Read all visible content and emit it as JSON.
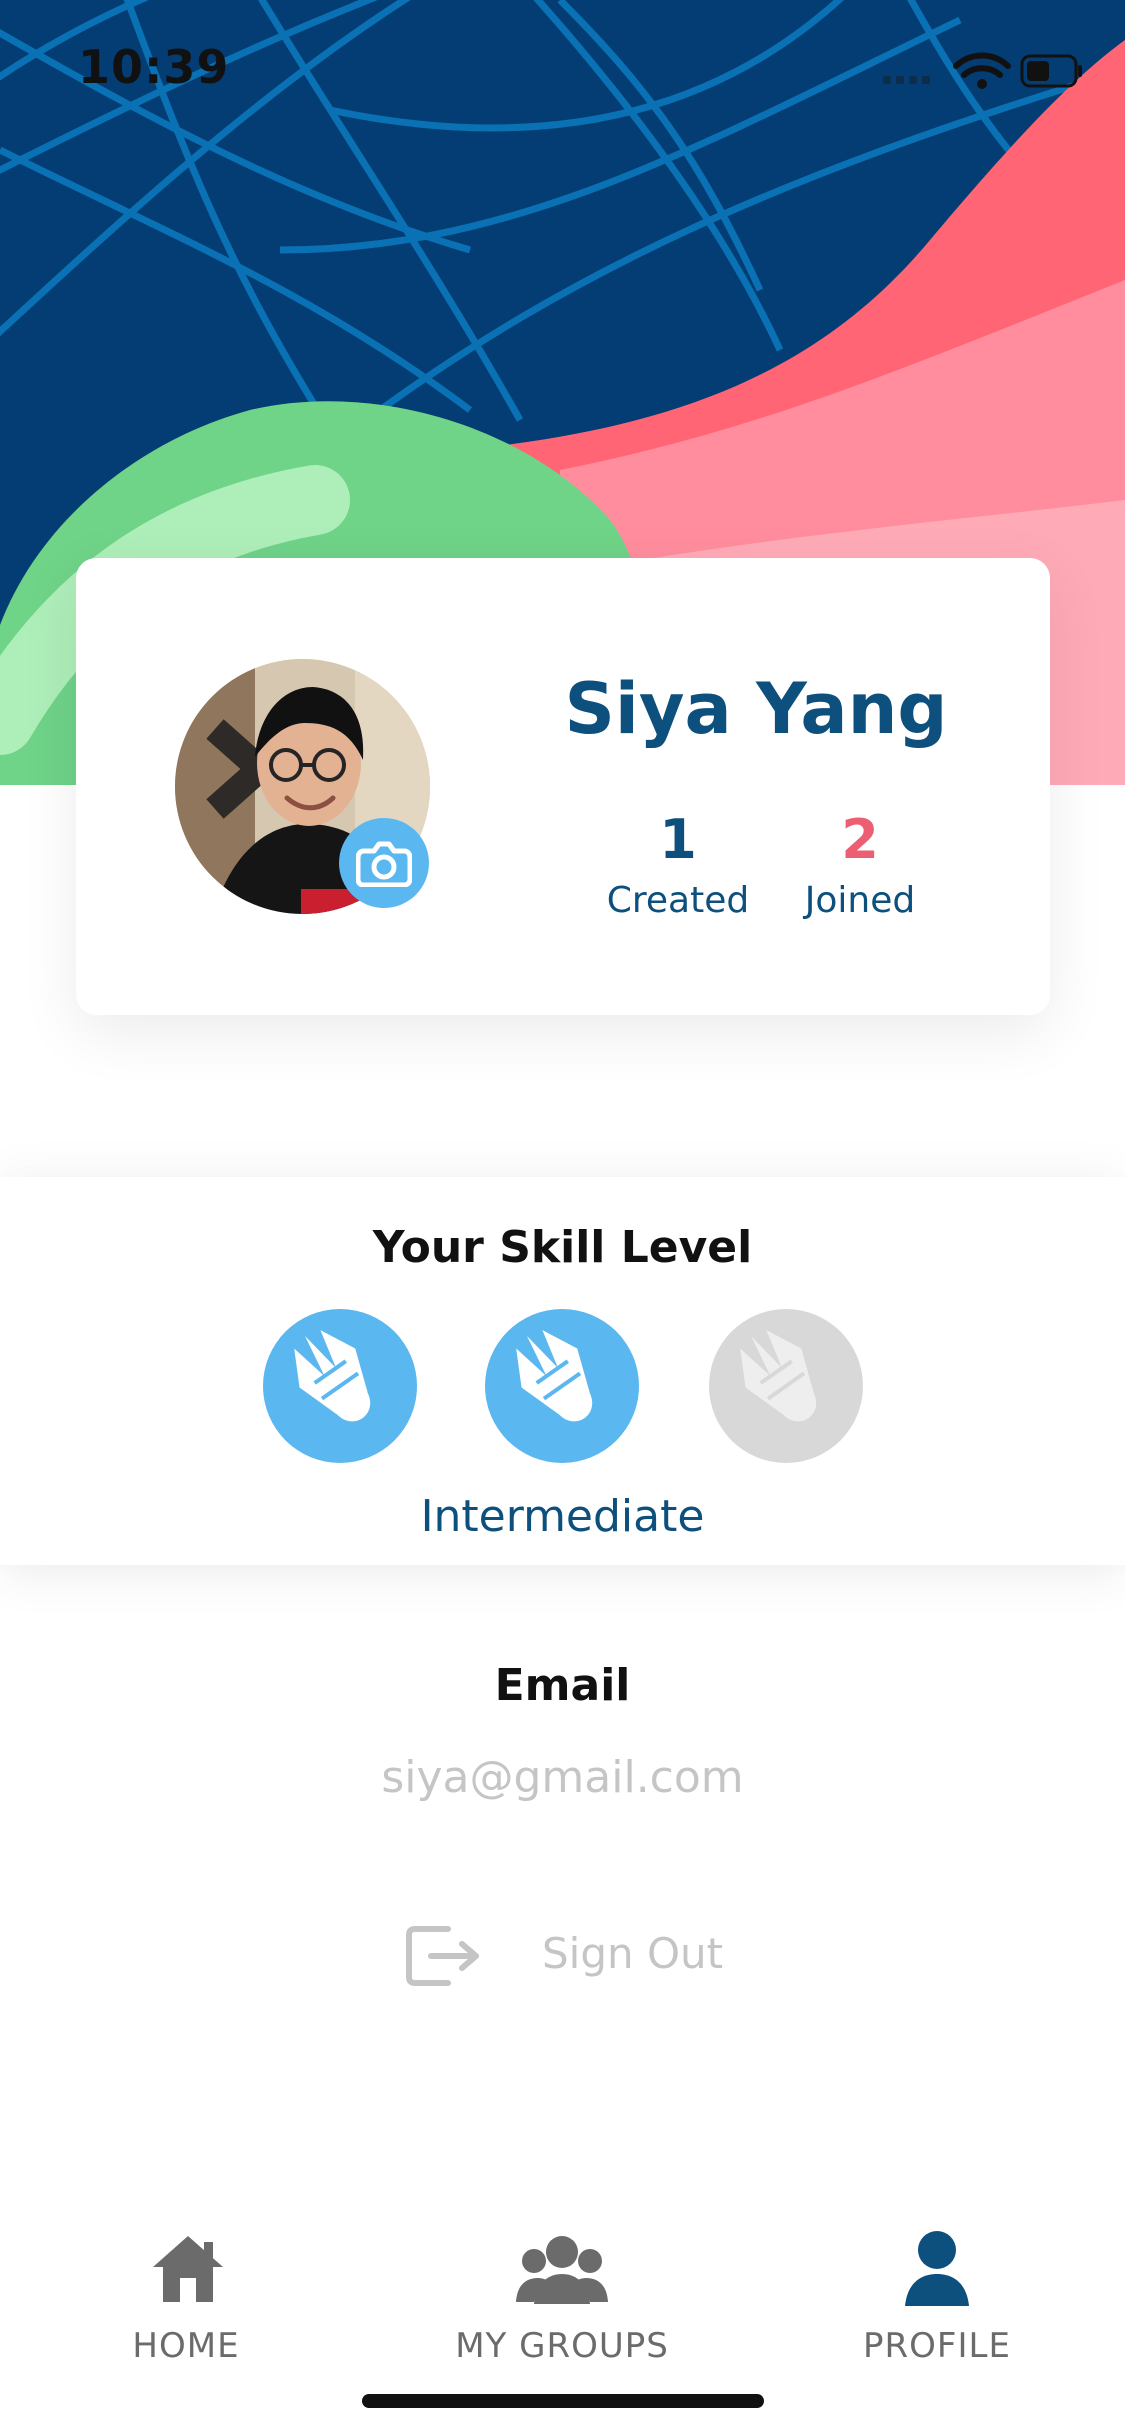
{
  "status_bar": {
    "time": "10:39",
    "icons": [
      "signal-icon",
      "wifi-icon",
      "battery-icon"
    ]
  },
  "profile": {
    "name": "Siya Yang",
    "camera_icon": "camera-icon",
    "stats": [
      {
        "value": "1",
        "label": "Created",
        "color": "#0d4f7d"
      },
      {
        "value": "2",
        "label": "Joined",
        "color": "#ec5f72"
      }
    ]
  },
  "skill": {
    "title": "Your Skill Level",
    "level_label": "Intermediate",
    "rating": 2,
    "max_rating": 3,
    "icons": [
      "shuttlecock-icon",
      "shuttlecock-icon",
      "shuttlecock-icon"
    ]
  },
  "email": {
    "label": "Email",
    "value": "siya@gmail.com"
  },
  "signout": {
    "label": "Sign Out",
    "icon": "sign-out-icon"
  },
  "nav": {
    "items": [
      {
        "label": "HOME",
        "icon": "home-icon"
      },
      {
        "label": "MY GROUPS",
        "icon": "groups-icon"
      },
      {
        "label": "PROFILE",
        "icon": "profile-icon"
      }
    ],
    "active_index": 2,
    "active_color": "#0d4f7d",
    "inactive_color": "#6b6b6b"
  },
  "colors": {
    "hero_background": "#043d73",
    "accent_blue": "#5bb7ef",
    "accent_pink": "#ec5f72",
    "accent_green": "#6fd388"
  }
}
